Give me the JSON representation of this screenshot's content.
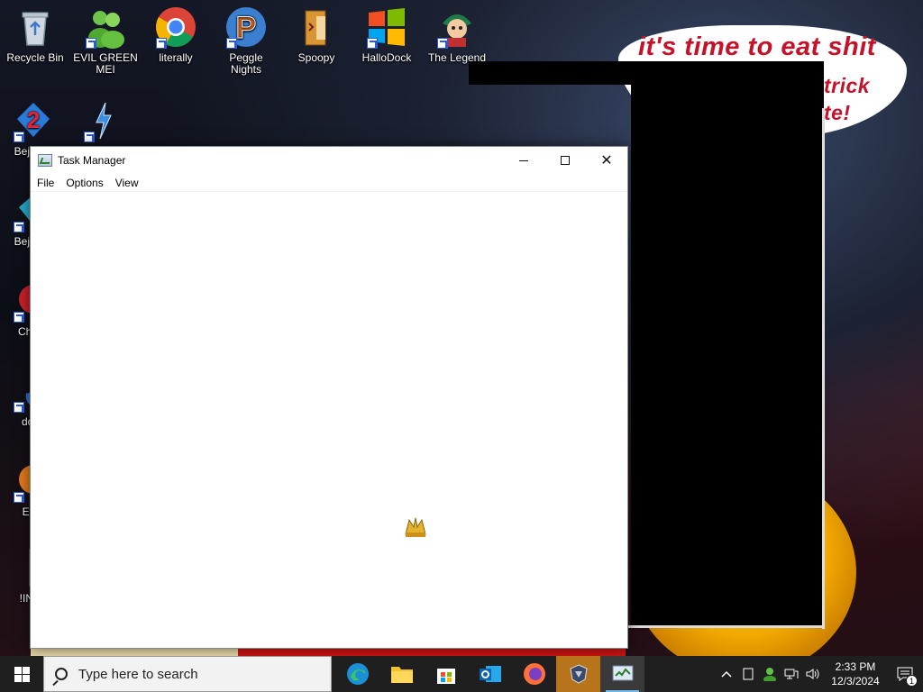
{
  "desktop": {
    "top_icons": [
      {
        "label": "Recycle Bin",
        "icon": "recycle-bin-icon",
        "shortcut": false
      },
      {
        "label": "EVIL GREEN MEI",
        "icon": "green-people-icon",
        "shortcut": true
      },
      {
        "label": "literally",
        "icon": "chrome-icon",
        "shortcut": true
      },
      {
        "label": "Peggle Nights",
        "icon": "peggle-icon",
        "shortcut": true
      },
      {
        "label": "Spoopy",
        "icon": "spoopy-icon",
        "shortcut": false
      },
      {
        "label": "HalloDock",
        "icon": "windows-flag-icon",
        "shortcut": true
      },
      {
        "label": "The Legend",
        "icon": "legend-character-icon",
        "shortcut": true
      }
    ],
    "left_icons": [
      {
        "label": "Beje De",
        "icon": "bejeweled-2-icon"
      },
      {
        "label": "Beje De",
        "icon": "bejeweled-gem-icon"
      },
      {
        "label": "Ch De",
        "icon": "red-game-icon"
      },
      {
        "label": "does",
        "icon": "blue-flame-icon"
      },
      {
        "label": "Ever",
        "icon": "orange-game-icon"
      },
      {
        "label": "!INST",
        "icon": "installer-icon"
      }
    ],
    "second_row_icon": {
      "label": "",
      "icon": "lightning-icon"
    },
    "wallpaper_text": {
      "line1": "it's time to eat shit",
      "line2": "trick",
      "line3": "te!"
    }
  },
  "task_manager": {
    "title": "Task Manager",
    "menu": [
      "File",
      "Options",
      "View"
    ],
    "controls": {
      "minimize": "minimize",
      "maximize": "maximize",
      "close": "✕"
    }
  },
  "taskbar": {
    "search_placeholder": "Type here to search",
    "apps": [
      {
        "name": "edge-icon",
        "active": false
      },
      {
        "name": "file-explorer-icon",
        "active": false
      },
      {
        "name": "microsoft-store-icon",
        "active": false
      },
      {
        "name": "outlook-icon",
        "active": false
      },
      {
        "name": "firefox-icon",
        "active": false
      },
      {
        "name": "shield-game-icon",
        "active": true
      },
      {
        "name": "task-manager-icon",
        "active": true
      }
    ],
    "time": "2:33 PM",
    "date": "12/3/2024",
    "notification_count": "1"
  }
}
